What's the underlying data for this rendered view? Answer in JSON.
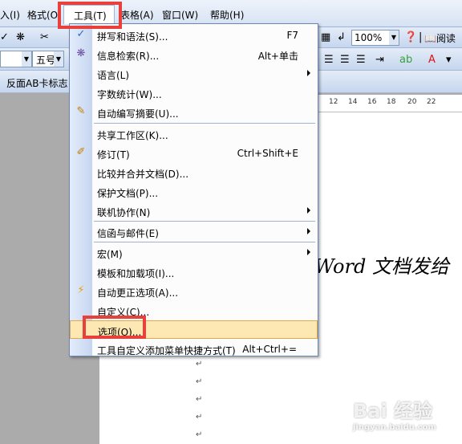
{
  "menubar": {
    "partial_left": "入(I)",
    "format": "格式(O)",
    "tools": "工具(T)",
    "table": "表格(A)",
    "window": "窗口(W)",
    "help": "帮助(H)"
  },
  "toolbar": {
    "zoom": "100%",
    "read": "阅读",
    "font_size": "五号",
    "toolbar3_text": "反面AB卡标志"
  },
  "ruler": [
    "12",
    "14",
    "16",
    "18",
    "20",
    "22"
  ],
  "document": {
    "heading": "Word 文档发给",
    "para_mark": "↵"
  },
  "tools_menu": {
    "items": [
      {
        "label": "拼写和语法(S)...",
        "shortcut": "F7",
        "icon": "spell-check-icon"
      },
      {
        "label": "信息检索(R)...",
        "shortcut": "Alt+单击",
        "icon": "research-icon"
      },
      {
        "label": "语言(L)",
        "submenu": true
      },
      {
        "label": "字数统计(W)..."
      },
      {
        "label": "自动编写摘要(U)...",
        "icon": "auto-summarize-icon"
      },
      {
        "label": "共享工作区(K)..."
      },
      {
        "label": "修订(T)",
        "shortcut": "Ctrl+Shift+E",
        "icon": "track-changes-icon"
      },
      {
        "label": "比较并合并文档(D)..."
      },
      {
        "label": "保护文档(P)..."
      },
      {
        "label": "联机协作(N)",
        "submenu": true
      },
      {
        "label": "信函与邮件(E)",
        "submenu": true
      },
      {
        "label": "宏(M)",
        "submenu": true
      },
      {
        "label": "模板和加载项(I)..."
      },
      {
        "label": "自动更正选项(A)...",
        "icon": "autocorrect-icon"
      },
      {
        "label": "自定义(C)..."
      },
      {
        "label": "选项(O)..."
      },
      {
        "label": "工具自定义添加菜单快捷方式(T)",
        "shortcut": "Alt+Ctrl+="
      }
    ]
  },
  "watermark": {
    "text": "Bai 经验",
    "sub": "jingyan.baidu.com"
  },
  "colors": {
    "highlight": "#fde7b3",
    "annotation": "#e8403a",
    "gutter": "#c6d6f0"
  }
}
